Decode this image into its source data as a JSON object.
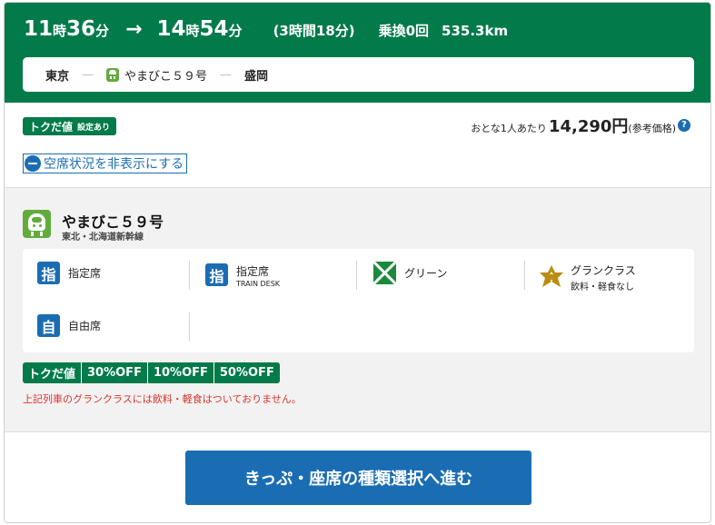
{
  "header": {
    "depart_hour": "11",
    "hour_unit": "時",
    "depart_min": "36",
    "min_unit": "分",
    "arrow": "→",
    "arrive_hour": "14",
    "arrive_min": "54",
    "duration": "(3時間18分)",
    "transfers": "乗換0回",
    "distance": "535.3km",
    "route": {
      "from": "東京",
      "separator": "—",
      "train": "やまびこ５９号",
      "to": "盛岡"
    }
  },
  "fare": {
    "badge_label": "トクだ値",
    "badge_sub": "設定あり",
    "price_prefix": "おとな1人あたり",
    "price": "14,290円",
    "price_note": "(参考価格)",
    "help_icon": "?"
  },
  "vacancy_toggle": {
    "label": "空席状況を非表示にする"
  },
  "train": {
    "name": "やまびこ５９号",
    "line": "東北・北海道新幹線",
    "icon_color": "#62ac3c"
  },
  "seats": [
    {
      "icon_char": "指",
      "label": "指定席",
      "sub": ""
    },
    {
      "icon_char": "指",
      "label": "指定席",
      "sub": "TRAIN DESK"
    },
    {
      "icon": "green-car-icon",
      "label": "グリーン",
      "sub": ""
    },
    {
      "icon": "gran-class-icon",
      "label": "グランクラス",
      "sub": "飲料・軽食なし"
    },
    {
      "icon_char": "自",
      "label": "自由席",
      "sub": ""
    }
  ],
  "discounts": [
    "トクだ値",
    "30%OFF",
    "10%OFF",
    "50%OFF"
  ],
  "notice": "上記列車のグランクラスには飲料・軽食はついておりません。",
  "cta": {
    "label": "きっぷ・座席の種類選択へ進む"
  },
  "colors": {
    "brand_green": "#027a4a",
    "link_blue": "#1b6db3",
    "notice_red": "#d9342b",
    "gran_gold": "#b98e0f"
  }
}
